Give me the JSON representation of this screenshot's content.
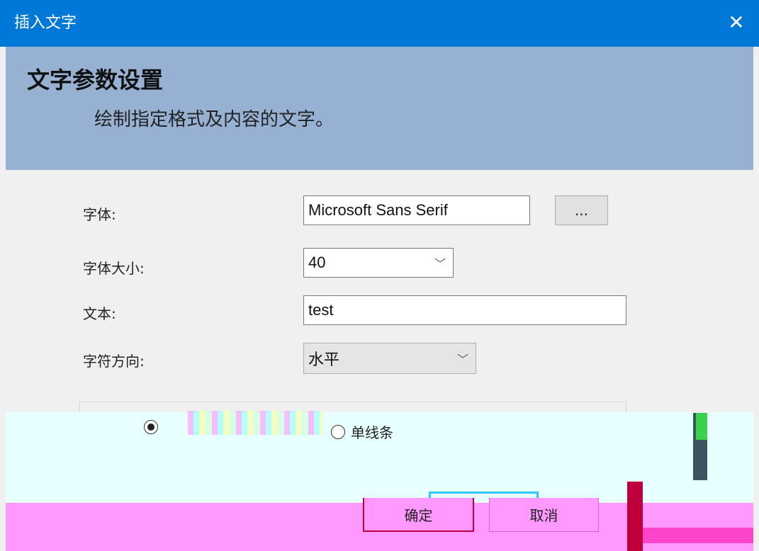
{
  "window": {
    "title": "插入文字",
    "close_glyph": "✕"
  },
  "header": {
    "heading": "文字参数设置",
    "description": "绘制指定格式及内容的文字。"
  },
  "form": {
    "font_label": "字体:",
    "font_value": "Microsoft Sans Serif",
    "font_browse_label": "...",
    "size_label": "字体大小:",
    "size_value": "40",
    "text_label": "文本:",
    "text_value": "test",
    "direction_label": "字符方向:",
    "direction_value": "水平"
  },
  "stroke_options": {
    "selected": "first",
    "option2_label": "单线条"
  },
  "buttons": {
    "ok_label": "确定",
    "cancel_label": "取消"
  },
  "colors": {
    "titlebar": "#0078d7",
    "header": "#97b1d3",
    "artifact_cyan": "#e8ffff",
    "artifact_magenta": "#ff99ff"
  }
}
